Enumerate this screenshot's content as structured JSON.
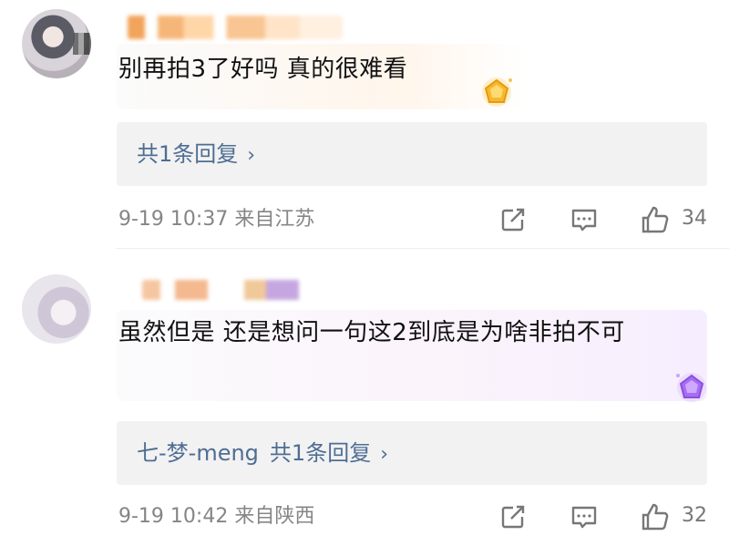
{
  "comments": [
    {
      "text": "别再拍3了好吗 真的很难看",
      "reply_user": "",
      "reply_summary": "共1条回复",
      "chevron": "›",
      "time": "9-19 10:37",
      "location": "来自江苏",
      "likes": "34"
    },
    {
      "text": "虽然但是 还是想问一句这2到底是为啥非拍不可",
      "reply_user": "七-梦-meng",
      "reply_summary": "共1条回复",
      "chevron": "›",
      "time": "9-19 10:42",
      "location": "来自陕西",
      "likes": "32"
    }
  ],
  "colors": {
    "link": "#4f6d94",
    "meta": "#858585",
    "reply_bg": "#f2f2f2"
  },
  "icons": {
    "share": "share-icon",
    "comment": "comment-icon",
    "like": "thumbs-up-icon",
    "badge_gold": "gold-gem-badge-icon",
    "badge_purple": "purple-gem-badge-icon"
  }
}
